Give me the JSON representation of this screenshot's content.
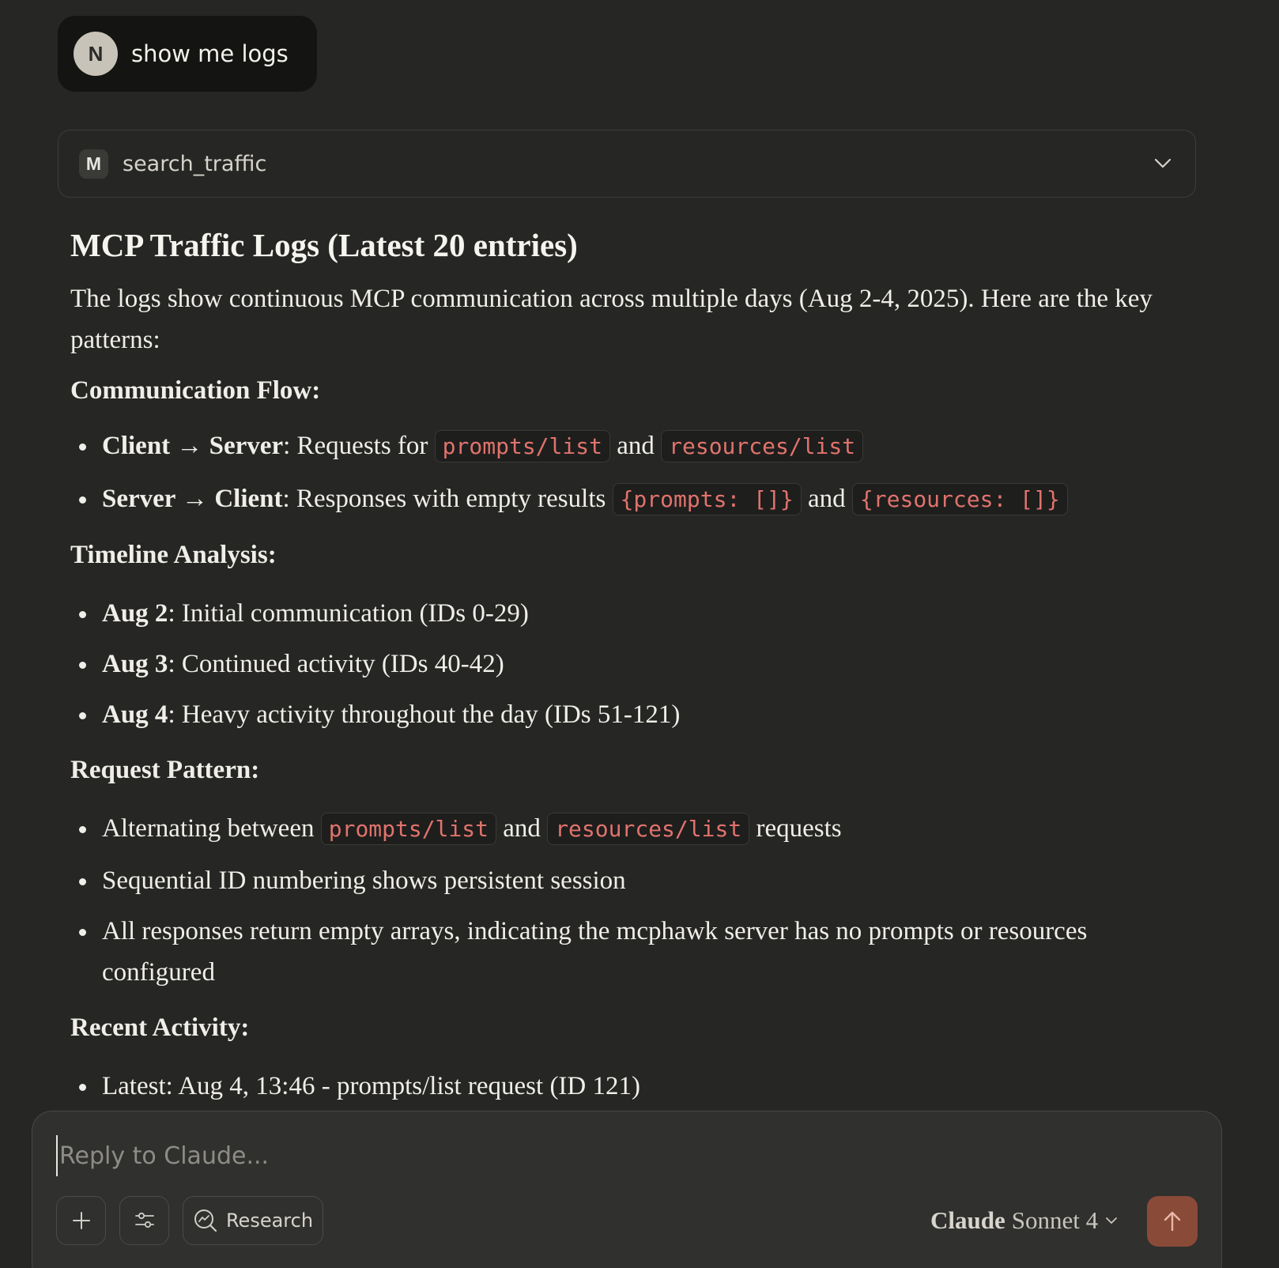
{
  "user_message": {
    "avatar_initial": "N",
    "text": "show me logs"
  },
  "tool_call": {
    "badge": "M",
    "name": "search_traffic"
  },
  "response": {
    "title": "MCP Traffic Logs (Latest 20 entries)",
    "intro": "The logs show continuous MCP communication across multiple days (Aug 2-4, 2025). Here are the key patterns:",
    "sections": {
      "communication": {
        "heading": "Communication Flow:",
        "item1": {
          "label": "Client → Server",
          "text1": ": Requests for ",
          "code1": "prompts/list",
          "text2": " and ",
          "code2": "resources/list"
        },
        "item2": {
          "label": "Server → Client",
          "text1": ": Responses with empty results ",
          "code1": "{prompts: []}",
          "text2": " and ",
          "code2": "{resources: []}"
        }
      },
      "timeline": {
        "heading": "Timeline Analysis:",
        "items": [
          {
            "label": "Aug 2",
            "text": ": Initial communication (IDs 0-29)"
          },
          {
            "label": "Aug 3",
            "text": ": Continued activity (IDs 40-42)"
          },
          {
            "label": "Aug 4",
            "text": ": Heavy activity throughout the day (IDs 51-121)"
          }
        ]
      },
      "request_pattern": {
        "heading": "Request Pattern:",
        "item1": {
          "text1": "Alternating between ",
          "code1": "prompts/list",
          "text2": " and ",
          "code2": "resources/list",
          "text3": " requests"
        },
        "item2": "Sequential ID numbering shows persistent session",
        "item3": "All responses return empty arrays, indicating the mcphawk server has no prompts or resources configured"
      },
      "recent": {
        "heading": "Recent Activity:",
        "item1": "Latest: Aug 4, 13:46 - prompts/list request (ID 121)"
      }
    }
  },
  "composer": {
    "placeholder": "Reply to Claude...",
    "research_label": "Research",
    "model_brand": "Claude",
    "model_name": "Sonnet 4"
  },
  "icons": {
    "tool_chevron": "chevron-down-icon",
    "plus": "plus-icon",
    "tools": "sliders-icon",
    "research": "research-search-icon",
    "send": "arrow-up-icon"
  },
  "colors": {
    "background": "#262624",
    "code_text": "#e0736c",
    "send_button": "#8a4a38"
  }
}
